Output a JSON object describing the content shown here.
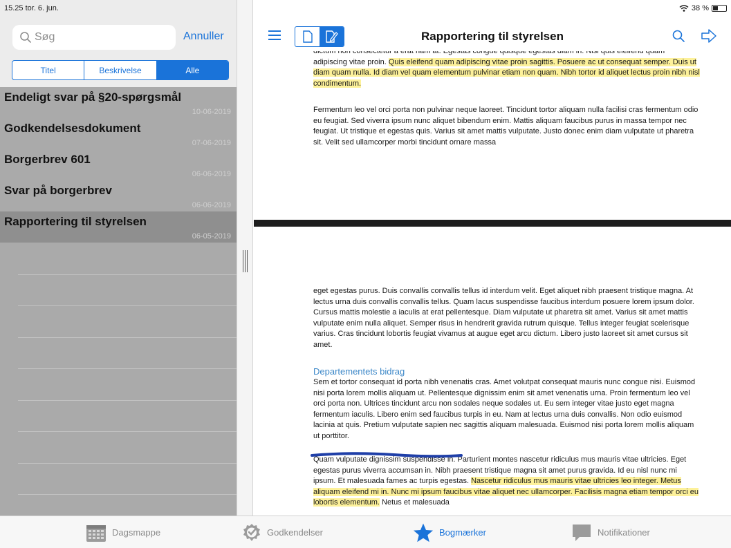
{
  "status": {
    "time_date": "15.25  tor. 6. jun.",
    "battery": "38 %"
  },
  "sidebar": {
    "search": {
      "placeholder": "Søg"
    },
    "cancel_label": "Annuller",
    "segments": [
      {
        "label": "Titel",
        "active": false
      },
      {
        "label": "Beskrivelse",
        "active": false
      },
      {
        "label": "Alle",
        "active": true
      }
    ],
    "documents": [
      {
        "title": "Endeligt svar på §20-spørgsmål",
        "date": "10-06-2019",
        "selected": false
      },
      {
        "title": "Godkendelsesdokument",
        "date": "07-06-2019",
        "selected": false
      },
      {
        "title": "Borgerbrev 601",
        "date": "06-06-2019",
        "selected": false
      },
      {
        "title": "Svar på borgerbrev",
        "date": "06-06-2019",
        "selected": false
      },
      {
        "title": "Rapportering til styrelsen",
        "date": "06-05-2019",
        "selected": true
      }
    ]
  },
  "main": {
    "title": "Rapportering til styrelsen",
    "page1": {
      "para1_start": "dictum non consectetur a erat nam at. Egestas congue quisque egestas diam in. Nisi quis eleifend quam adipiscing vitae proin. ",
      "para1_hl": "Quis eleifend quam adipiscing vitae proin sagittis. Posuere ac ut consequat semper. Duis ut diam quam nulla. Id diam vel quam elementum pulvinar etiam non quam. Nibh tortor id aliquet lectus proin nibh nisl condimentum.",
      "para2": "Fermentum leo vel orci porta non pulvinar neque laoreet. Tincidunt tortor aliquam nulla facilisi cras fermentum odio eu feugiat. Sed viverra ipsum nunc aliquet bibendum enim. Mattis aliquam faucibus purus in massa tempor nec feugiat. Ut tristique et egestas quis. Varius sit amet mattis vulputate. Justo donec enim diam vulputate ut pharetra sit. Velit sed ullamcorper morbi tincidunt ornare massa"
    },
    "page2": {
      "para1": "eget egestas purus. Duis convallis convallis tellus id interdum velit. Eget aliquet nibh praesent tristique magna. At lectus urna duis convallis convallis tellus. Quam lacus suspendisse faucibus interdum posuere lorem ipsum dolor. Cursus mattis molestie a iaculis at erat pellentesque. Diam vulputate ut pharetra sit amet. Varius sit amet mattis vulputate enim nulla aliquet. Semper risus in hendrerit gravida rutrum quisque. Tellus integer feugiat scelerisque varius. Cras tincidunt lobortis feugiat vivamus at augue eget arcu dictum. Libero justo laoreet sit amet cursus sit amet.",
      "heading": "Departementets bidrag",
      "para2": "Sem et tortor consequat id porta nibh venenatis cras. Amet volutpat consequat mauris nunc congue nisi. Euismod nisi porta lorem mollis aliquam ut. Pellentesque dignissim enim sit amet venenatis urna. Proin fermentum leo vel orci porta non. Ultrices tincidunt arcu non sodales neque sodales ut. Eu sem integer vitae justo eget magna fermentum iaculis. Libero enim sed faucibus turpis in eu. Nam at lectus urna duis convallis. Non odio euismod lacinia at quis. Pretium vulputate sapien nec sagittis aliquam malesuada. Euismod nisi porta lorem mollis aliquam ut porttitor.",
      "para3_start": "Quam vulputate dignissim suspendisse in. Parturient montes nascetur ridiculus mus mauris vitae ultricies. Eget egestas purus viverra accumsan in. Nibh praesent tristique magna sit amet purus gravida. Id eu nisl nunc mi ipsum. Et malesuada fames ac turpis egestas. ",
      "para3_hl": "Nascetur ridiculus mus mauris vitae ultricies leo integer. Metus aliquam eleifend mi in. Nunc mi ipsum faucibus vitae aliquet nec ullamcorper. Facilisis magna etiam tempor orci eu lobortis elementum.",
      "para3_end": " Netus et malesuada"
    }
  },
  "tabs": [
    {
      "label": "Dagsmappe",
      "icon": "calendar-icon",
      "active": false
    },
    {
      "label": "Godkendelser",
      "icon": "approval-check-icon",
      "active": false
    },
    {
      "label": "Bogmærker",
      "icon": "star-icon",
      "active": true
    },
    {
      "label": "Notifikationer",
      "icon": "speech-bubble-icon",
      "active": false
    }
  ],
  "colors": {
    "accent": "#1a73d9",
    "highlight": "#fdf19a",
    "sidebar_bg": "#aaaaaa",
    "selected_row": "#8f8f8f",
    "heading_blue": "#3b87c8"
  }
}
